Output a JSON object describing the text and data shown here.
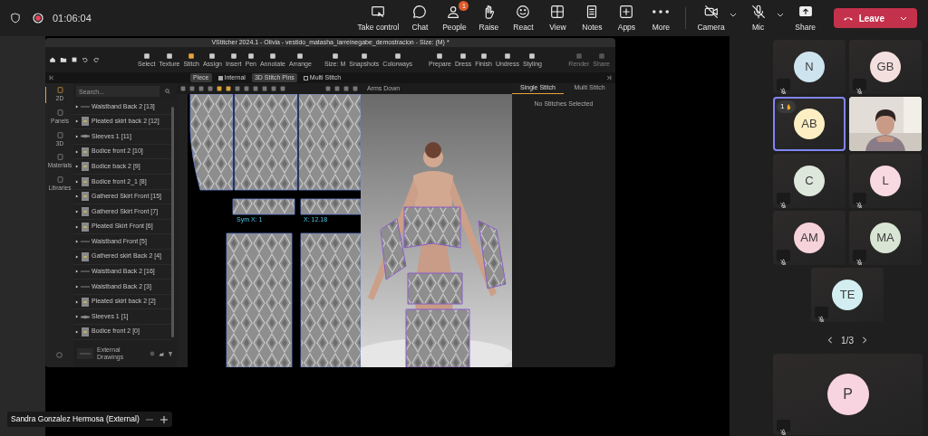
{
  "meeting": {
    "timer": "01:06:04"
  },
  "toolbar": [
    {
      "label": "Take control"
    },
    {
      "label": "Chat"
    },
    {
      "label": "People",
      "badge": "1"
    },
    {
      "label": "Raise"
    },
    {
      "label": "React"
    },
    {
      "label": "View"
    },
    {
      "label": "Notes"
    },
    {
      "label": "Apps"
    },
    {
      "label": "More"
    },
    {
      "label": "Camera",
      "on": false
    },
    {
      "label": "Mic",
      "on": false
    },
    {
      "label": "Share"
    }
  ],
  "leave_button": {
    "label": "Leave"
  },
  "shared_app": {
    "title": "VStitcher 2024.1 - Olivia - vestido_matasha_larreinegabe_demostracion - Size: (M) *",
    "tool_groups": [
      {
        "tools": [
          {
            "label": "Select",
            "selected": false,
            "disabled": false
          },
          {
            "label": "Texture",
            "selected": false,
            "disabled": false
          },
          {
            "label": "Stitch",
            "selected": true,
            "disabled": false
          },
          {
            "label": "Assign",
            "selected": false,
            "disabled": false
          },
          {
            "label": "Insert",
            "selected": false,
            "disabled": false
          },
          {
            "label": "Pen",
            "selected": false,
            "disabled": false
          },
          {
            "label": "Annotate",
            "selected": false,
            "disabled": false
          },
          {
            "label": "Arrange",
            "selected": false,
            "disabled": false
          }
        ]
      },
      {
        "tools": [
          {
            "label": "Size: M",
            "selected": false,
            "disabled": false
          },
          {
            "label": "Snapshots",
            "selected": false,
            "disabled": false
          },
          {
            "label": "Colorways",
            "selected": false,
            "disabled": false
          }
        ]
      },
      {
        "tools": [
          {
            "label": "Prepare",
            "selected": false,
            "disabled": false
          },
          {
            "label": "Dress",
            "selected": false,
            "disabled": false
          },
          {
            "label": "Finish",
            "selected": false,
            "disabled": false
          },
          {
            "label": "Undress",
            "selected": false,
            "disabled": false
          },
          {
            "label": "Styling",
            "selected": false,
            "disabled": false
          }
        ]
      },
      {
        "tools": [
          {
            "label": "Render",
            "selected": false,
            "disabled": true
          },
          {
            "label": "Share",
            "selected": false,
            "disabled": true
          }
        ]
      }
    ],
    "options": [
      {
        "label": "Piece",
        "kind": "toggle",
        "checked": true
      },
      {
        "label": "Internal",
        "kind": "checkbox",
        "checked": true
      },
      {
        "label": "3D Stitch Pins",
        "kind": "toggle",
        "checked": true
      },
      {
        "label": "Multi Stitch",
        "kind": "checkbox",
        "checked": false
      }
    ],
    "rail": [
      {
        "label": "2D",
        "selected": true
      },
      {
        "label": "Panels",
        "selected": false
      },
      {
        "label": "3D",
        "selected": false
      },
      {
        "label": "Materials",
        "selected": false
      },
      {
        "label": "Libraries",
        "selected": false
      }
    ],
    "search": {
      "placeholder": "Search..."
    },
    "pieces": [
      {
        "name": "Waistband Back 2 [13]",
        "kind": "line"
      },
      {
        "name": "Pleated skirt back 2 [12]",
        "kind": "piece"
      },
      {
        "name": "Sleeves 1 [11]",
        "kind": "sleeve"
      },
      {
        "name": "Bodice front 2 [10]",
        "kind": "piece"
      },
      {
        "name": "Bodice back 2 [9]",
        "kind": "piece"
      },
      {
        "name": "Bodice front 2_1 [8]",
        "kind": "piece"
      },
      {
        "name": "Gathered Skirt Front [15]",
        "kind": "piece"
      },
      {
        "name": "Gathered Skirt Front [7]",
        "kind": "piece"
      },
      {
        "name": "Pleated Skirt Front [6]",
        "kind": "piece"
      },
      {
        "name": "Waistband Front [5]",
        "kind": "line"
      },
      {
        "name": "Gathered skirt Back 2 [4]",
        "kind": "piece"
      },
      {
        "name": "Waistband Back 2 [16]",
        "kind": "line"
      },
      {
        "name": "Waistband Back 2 [3]",
        "kind": "line"
      },
      {
        "name": "Pleated skirt back 2 [2]",
        "kind": "piece"
      },
      {
        "name": "Sleeves 1 [1]",
        "kind": "sleeve"
      },
      {
        "name": "Bodice front 2 [0]",
        "kind": "piece"
      }
    ],
    "footer": {
      "label": "External Drawings"
    },
    "viewport": {
      "pose": "Arms Down",
      "measures": [
        "Sym X: 1",
        "X: 12.18"
      ]
    },
    "stitch_tabs": [
      {
        "label": "Single Stitch",
        "selected": true
      },
      {
        "label": "Multi Stitch",
        "selected": false
      }
    ],
    "stitch_message": "No Stitches Selected"
  },
  "participants": [
    {
      "kind": "avatar",
      "initials": "N",
      "color": "#cde3ee",
      "muted": true,
      "active": false
    },
    {
      "kind": "avatar",
      "initials": "GB",
      "color": "#f3e0de",
      "muted": true,
      "active": false
    },
    {
      "kind": "avatar",
      "initials": "AB",
      "color": "#fdefc3",
      "muted": false,
      "active": true,
      "hand_count": "1"
    },
    {
      "kind": "video",
      "muted": false,
      "active": false
    },
    {
      "kind": "avatar",
      "initials": "C",
      "color": "#dde7dc",
      "muted": true,
      "active": false
    },
    {
      "kind": "avatar",
      "initials": "L",
      "color": "#f8d9e2",
      "muted": true,
      "active": false
    },
    {
      "kind": "avatar",
      "initials": "AM",
      "color": "#f6d2db",
      "muted": true,
      "active": false
    },
    {
      "kind": "avatar",
      "initials": "MA",
      "color": "#d9e5d4",
      "muted": true,
      "active": false
    },
    {
      "kind": "avatar",
      "initials": "TE",
      "color": "#d2eef1",
      "muted": true,
      "active": false
    }
  ],
  "pager": "1/3",
  "featured": {
    "initials": "P",
    "color": "#f7d4e0",
    "muted": true
  },
  "presenter": {
    "name": "Sandra Gonzalez Hermosa (External)"
  }
}
